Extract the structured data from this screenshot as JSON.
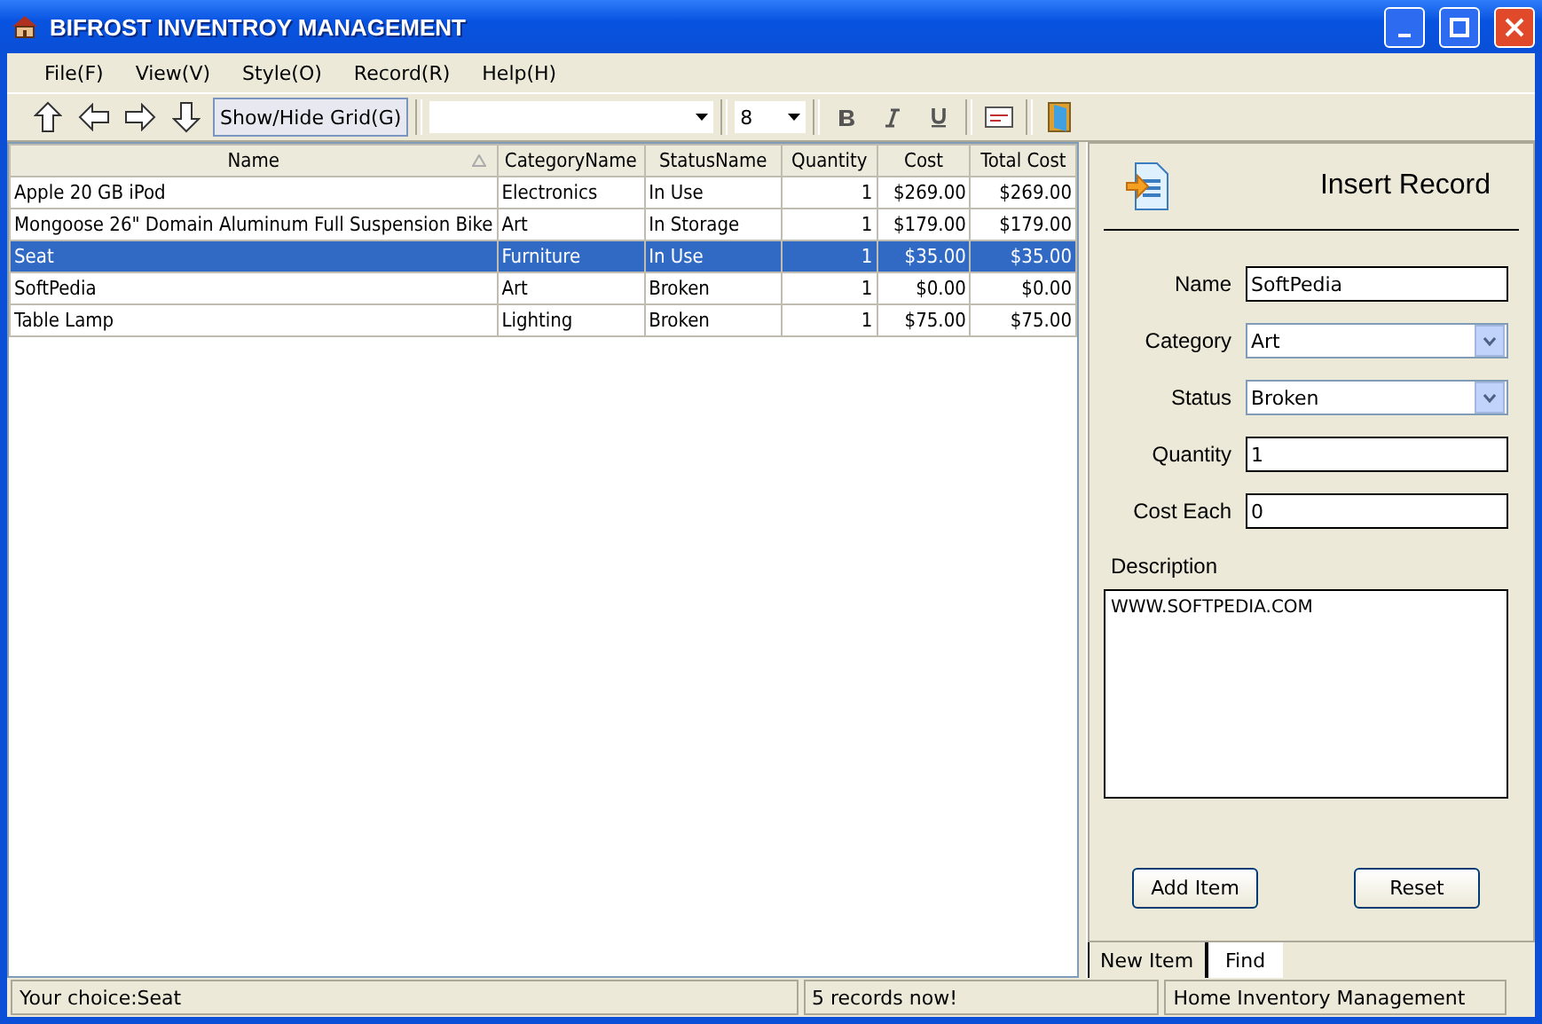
{
  "window": {
    "title": "BIFROST INVENTROY MANAGEMENT"
  },
  "menu": [
    "File(F)",
    "View(V)",
    "Style(O)",
    "Record(R)",
    "Help(H)"
  ],
  "toolbar": {
    "grid_button": "Show/Hide Grid(G)",
    "grid_button_pressed": true,
    "font_size": "8"
  },
  "table": {
    "columns": [
      {
        "label": "Name",
        "sorted": true
      },
      {
        "label": "CategoryName",
        "sorted": false
      },
      {
        "label": "StatusName",
        "sorted": false
      },
      {
        "label": "Quantity",
        "sorted": false
      },
      {
        "label": "Cost",
        "sorted": false
      },
      {
        "label": "Total Cost",
        "sorted": false
      }
    ],
    "rows": [
      {
        "cells": [
          "Apple 20 GB iPod",
          "Electronics",
          "In Use",
          "1",
          "$269.00",
          "$269.00"
        ],
        "selected": false
      },
      {
        "cells": [
          "Mongoose 26\" Domain Aluminum Full Suspension Bike",
          "Art",
          "In Storage",
          "1",
          "$179.00",
          "$179.00"
        ],
        "selected": false
      },
      {
        "cells": [
          "Seat",
          "Furniture",
          "In Use",
          "1",
          "$35.00",
          "$35.00"
        ],
        "selected": true
      },
      {
        "cells": [
          "SoftPedia",
          "Art",
          "Broken",
          "1",
          "$0.00",
          "$0.00"
        ],
        "selected": false
      },
      {
        "cells": [
          "Table Lamp",
          "Lighting",
          "Broken",
          "1",
          "$75.00",
          "$75.00"
        ],
        "selected": false
      }
    ]
  },
  "panel": {
    "title": "Insert Record",
    "fields": [
      {
        "label": "Name",
        "kind": "text",
        "value": "SoftPedia"
      },
      {
        "label": "Category",
        "kind": "dropdown",
        "value": "Art"
      },
      {
        "label": "Status",
        "kind": "dropdown",
        "value": "Broken"
      },
      {
        "label": "Quantity",
        "kind": "text",
        "value": "1"
      },
      {
        "label": "Cost Each",
        "kind": "text",
        "value": "0"
      }
    ],
    "description": {
      "label": "Description",
      "value": "WWW.SOFTPEDIA.COM"
    },
    "buttons": [
      "Add Item",
      "Reset"
    ],
    "tabs": [
      {
        "label": "New Item",
        "selected": true
      },
      {
        "label": "Find",
        "selected": false
      }
    ]
  },
  "status_bar": [
    "Your choice:Seat",
    "5  records  now!",
    "Home Inventory Management"
  ]
}
